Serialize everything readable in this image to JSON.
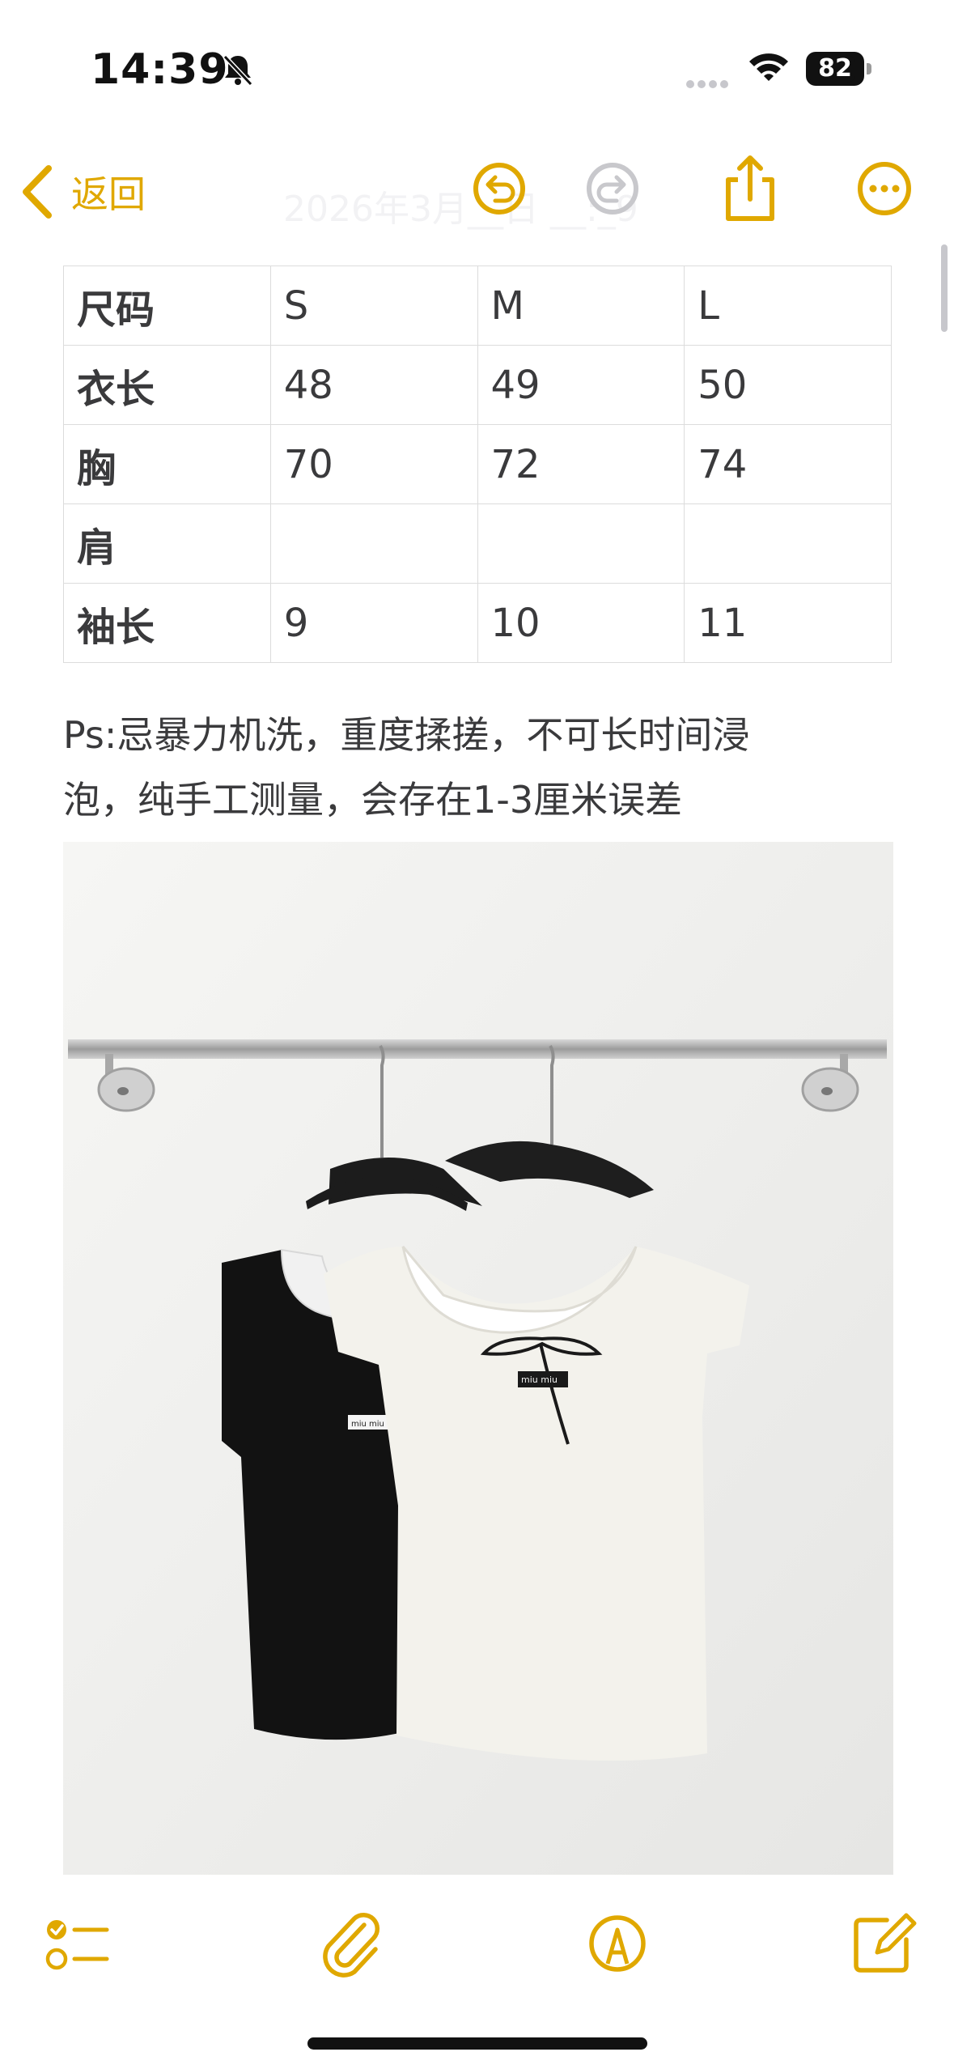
{
  "status_bar": {
    "time": "14:39",
    "battery_level": "82",
    "icons": [
      "bell-slash-icon",
      "cellular-signal-icon",
      "wifi-icon",
      "battery-icon"
    ]
  },
  "nav": {
    "back_label": "返回",
    "date_faded": "2026年3月__日 __:_9",
    "icons": [
      "chevron-left-icon",
      "undo-icon",
      "redo-icon",
      "share-icon",
      "more-icon"
    ],
    "accent_color": "#e0a800",
    "disabled_color": "#c8c8cc"
  },
  "size_table": {
    "header": [
      "尺码",
      "S",
      "M",
      "L"
    ],
    "rows": [
      [
        "衣长",
        "48",
        "49",
        "50"
      ],
      [
        "胸",
        "70",
        "72",
        "74"
      ],
      [
        "肩",
        "",
        "",
        ""
      ],
      [
        "袖长",
        "9",
        "10",
        "11"
      ]
    ]
  },
  "note": {
    "line1": "Ps:忌暴力机洗，重度揉搓，不可长时间浸",
    "line2": "泡，纯手工测量，会存在1-3厘米误差"
  },
  "photo": {
    "label_text": "miu miu"
  },
  "toolbar": {
    "icons": [
      "checklist-icon",
      "paperclip-icon",
      "markup-pen-icon",
      "compose-icon"
    ]
  }
}
